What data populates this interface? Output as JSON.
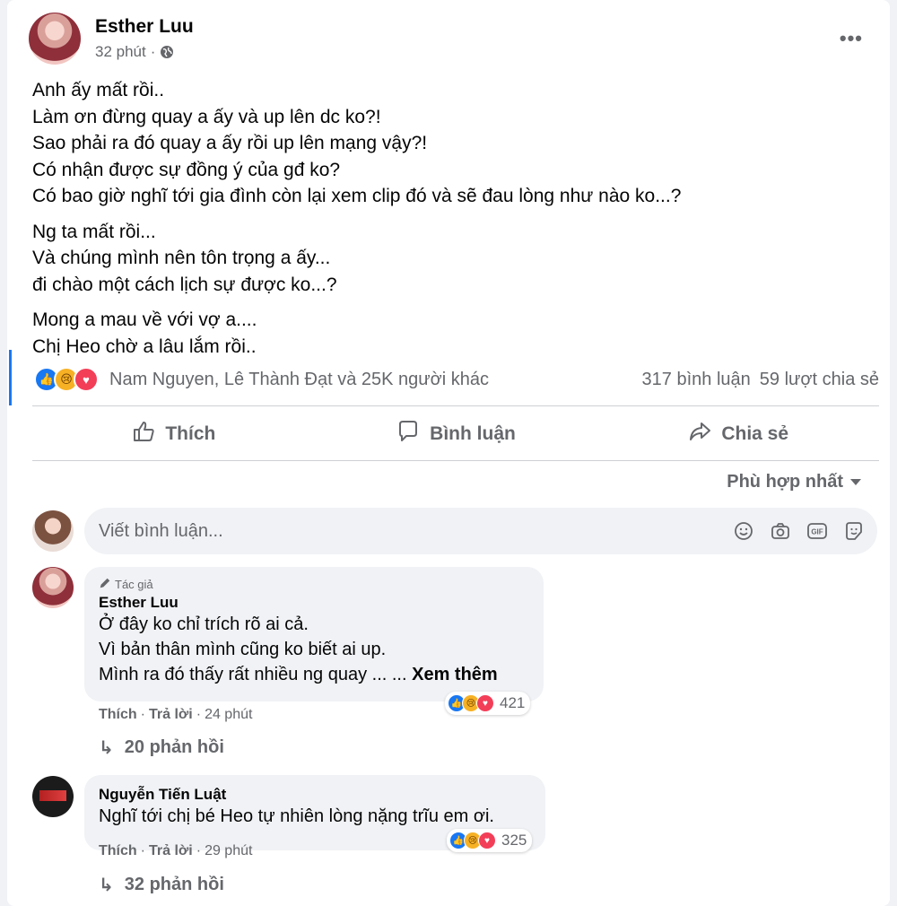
{
  "post": {
    "author": "Esther Luu",
    "time": "32 phút",
    "separator": "·",
    "more_icon": "more-horizontal-icon",
    "paragraphs": [
      [
        "Anh ấy mất rồi..",
        "Làm ơn đừng quay a ấy và up lên dc ko?!",
        "Sao phải ra đó quay a ấy rồi up lên mạng vậy?!",
        "Có nhận được sự đồng ý của gđ ko?",
        "Có bao giờ nghĩ tới gia đình còn lại xem clip đó và sẽ đau lòng như nào ko...?"
      ],
      [
        "Ng ta mất rồi...",
        "Và chúng mình nên tôn trọng a ấy...",
        "đi chào một cách lịch sự được ko...?"
      ],
      [
        "Mong a mau về với vợ a....",
        "Chị Heo chờ a lâu lắm rồi.."
      ]
    ],
    "reactions_text": "Nam Nguyen, Lê Thành Đạt và 25K người khác",
    "comments_count": "317 bình luận",
    "shares_count": "59 lượt chia sẻ"
  },
  "actions": {
    "like": "Thích",
    "comment": "Bình luận",
    "share": "Chia sẻ"
  },
  "sort_label": "Phù hợp nhất",
  "comment_input": {
    "placeholder": "Viết bình luận..."
  },
  "comments": [
    {
      "badge": "Tác giả",
      "name": "Esther Luu",
      "lines": [
        "Ở đây ko chỉ trích rõ ai cả.",
        "Vì bản thân mình cũng ko biết ai up.",
        "Mình ra đó thấy rất nhiều ng quay ... ..."
      ],
      "see_more": "Xem thêm",
      "reaction_count": "421",
      "like": "Thích",
      "reply": "Trả lời",
      "time": "24 phút",
      "replies": "20 phản hồi"
    },
    {
      "name": "Nguyễn Tiến Luật",
      "lines": [
        "Nghĩ tới chị bé Heo tự nhiên lòng nặng trĩu em ơi."
      ],
      "reaction_count": "325",
      "like": "Thích",
      "reply": "Trả lời",
      "time": "29 phút",
      "replies": "32 phản hồi"
    }
  ],
  "colors": {
    "accent": "#1877f2",
    "text": "#050505",
    "secondary": "#65676b",
    "bubble": "#f0f2f5",
    "love": "#f33e58",
    "sad": "#f7b125"
  }
}
